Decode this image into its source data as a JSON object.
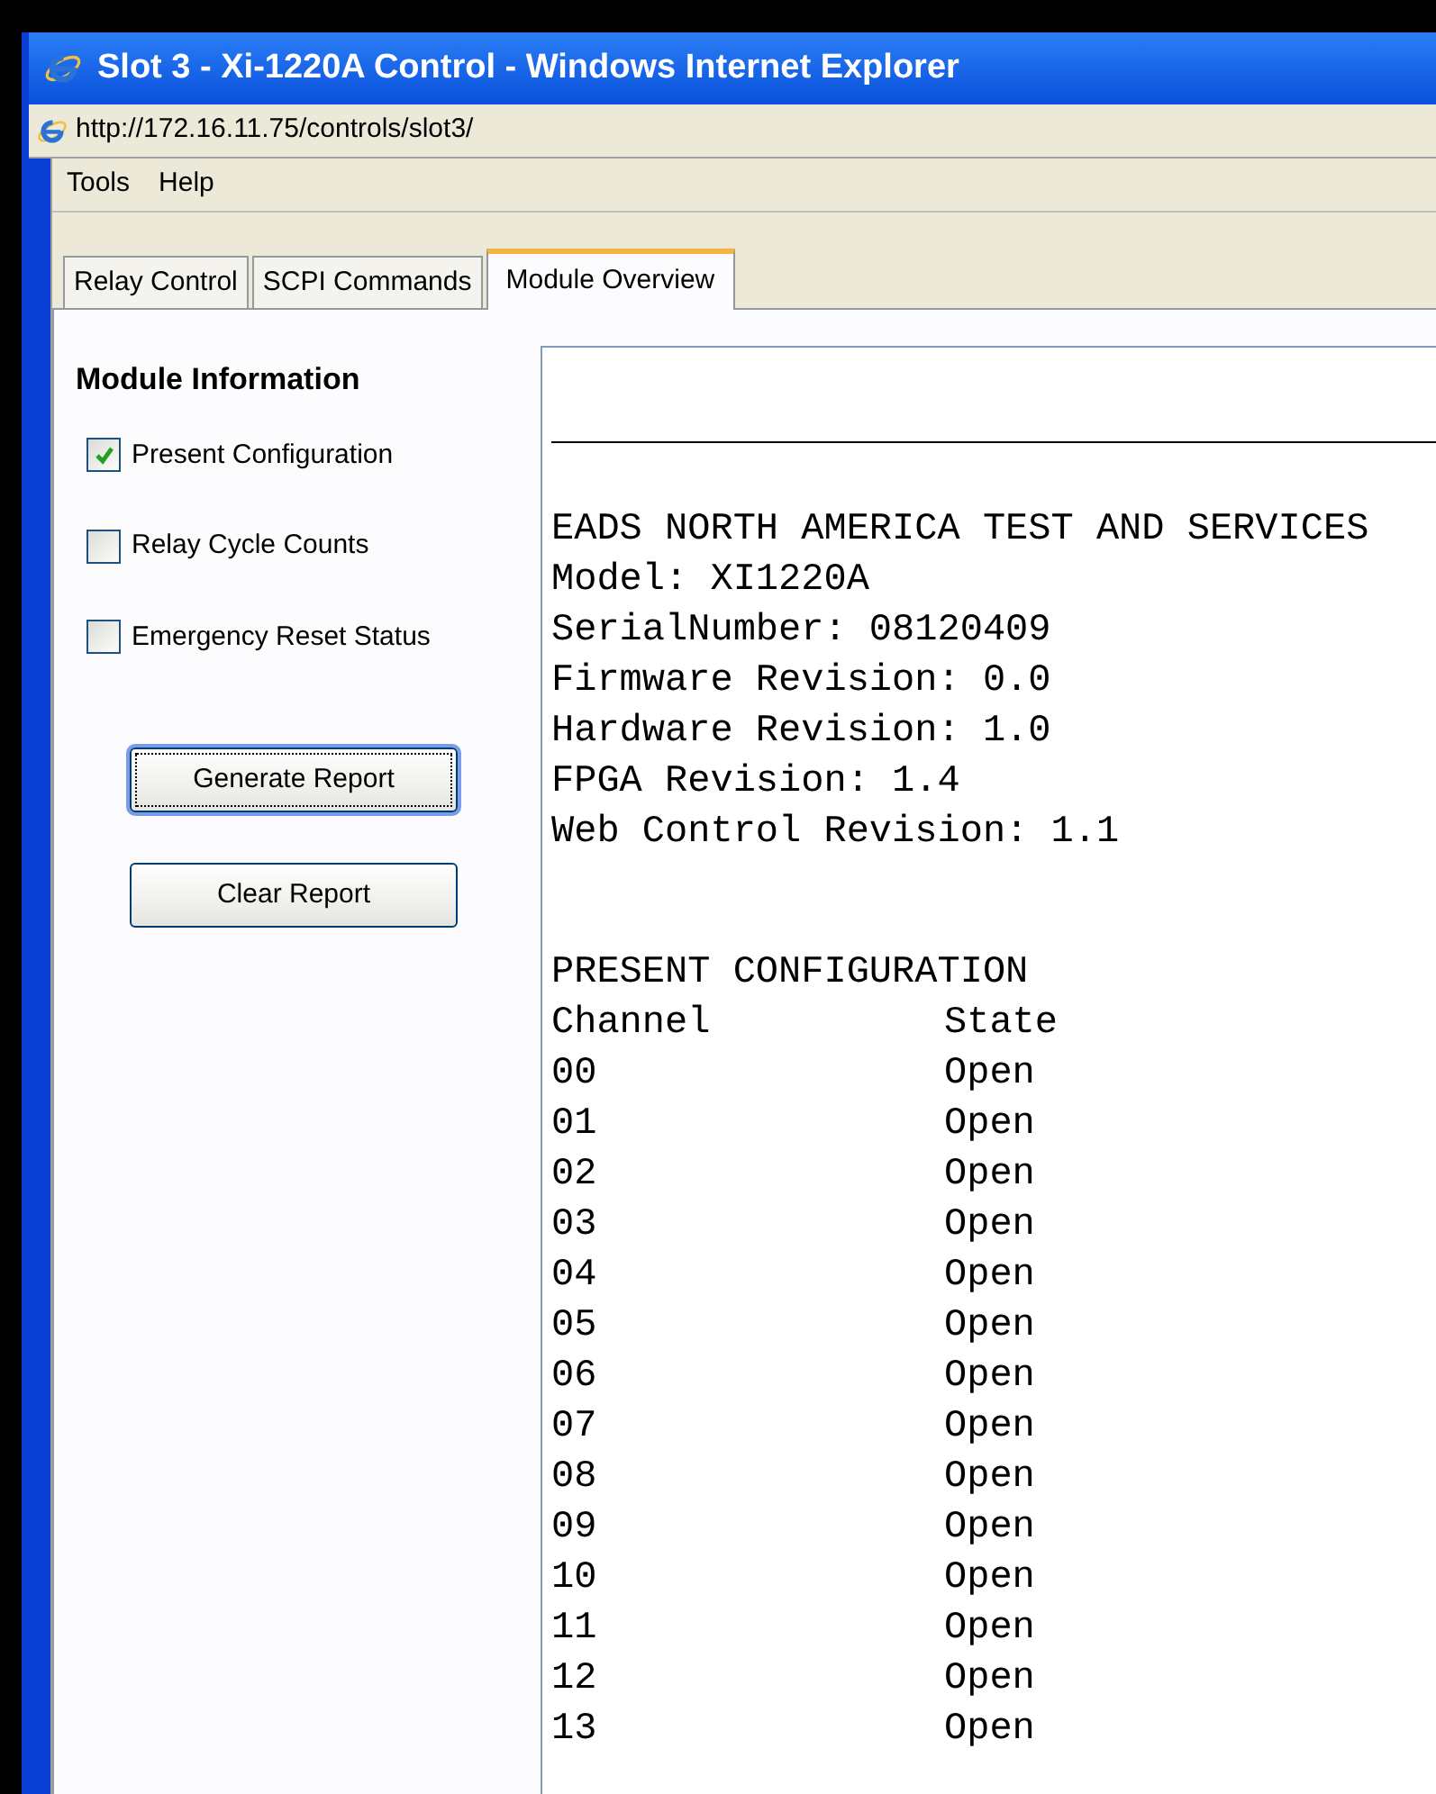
{
  "window": {
    "title": "Slot 3 - Xi-1220A Control - Windows Internet Explorer"
  },
  "address_bar": {
    "url": "http://172.16.11.75/controls/slot3/"
  },
  "menu": [
    "Tools",
    "Help"
  ],
  "tabs": [
    {
      "label": "Relay Control",
      "selected": false
    },
    {
      "label": "SCPI Commands",
      "selected": false
    },
    {
      "label": "Module Overview",
      "selected": true
    }
  ],
  "module_information": {
    "title": "Module Information",
    "options": [
      {
        "label": "Present Configuration",
        "checked": true
      },
      {
        "label": "Relay Cycle Counts",
        "checked": false
      },
      {
        "label": "Emergency Reset Status",
        "checked": false
      }
    ],
    "buttons": [
      {
        "label": "Generate Report",
        "focused": true
      },
      {
        "label": "Clear Report",
        "focused": false
      }
    ]
  },
  "report": {
    "header_lines": [
      "EADS NORTH AMERICA TEST AND SERVICES",
      "Model: XI1220A",
      "SerialNumber: 08120409",
      "Firmware Revision: 0.0",
      "Hardware Revision: 1.0",
      "FPGA Revision: 1.4",
      "Web Control Revision: 1.1"
    ],
    "config_title": "PRESENT CONFIGURATION",
    "columns": [
      "Channel",
      "State"
    ],
    "rows": [
      [
        "00",
        "Open"
      ],
      [
        "01",
        "Open"
      ],
      [
        "02",
        "Open"
      ],
      [
        "03",
        "Open"
      ],
      [
        "04",
        "Open"
      ],
      [
        "05",
        "Open"
      ],
      [
        "06",
        "Open"
      ],
      [
        "07",
        "Open"
      ],
      [
        "08",
        "Open"
      ],
      [
        "09",
        "Open"
      ],
      [
        "10",
        "Open"
      ],
      [
        "11",
        "Open"
      ],
      [
        "12",
        "Open"
      ],
      [
        "13",
        "Open"
      ]
    ]
  }
}
